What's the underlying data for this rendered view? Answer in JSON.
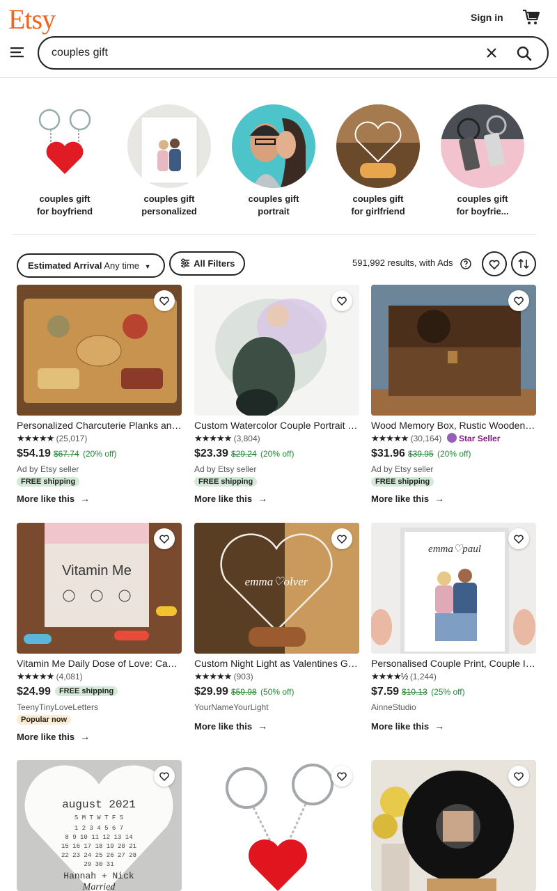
{
  "header": {
    "logo": "Etsy",
    "sign_in": "Sign in",
    "search_value": "couples gift"
  },
  "related": [
    {
      "line1": "couples gift",
      "line2": "for boyfriend"
    },
    {
      "line1": "couples gift",
      "line2": "personalized"
    },
    {
      "line1": "couples gift",
      "line2": "portrait"
    },
    {
      "line1": "couples gift",
      "line2": "for girlfriend"
    },
    {
      "line1": "couples gift",
      "line2": "for boyfrie..."
    }
  ],
  "filters": {
    "arrival_label": "Estimated Arrival",
    "arrival_value": "Any time",
    "all_filters": "All Filters",
    "results": "591,992 results, with Ads"
  },
  "listings": [
    {
      "title": "Personalized Charcuterie Planks and Cheese Board",
      "stars": "★★★★★",
      "reviews": "(25,017)",
      "price": "$54.19",
      "orig": "$67.74",
      "disc": "(20% off)",
      "seller": "Ad by Etsy seller",
      "badge": "FREE shipping",
      "more": "More like this"
    },
    {
      "title": "Custom Watercolor Couple Portrait from Photo",
      "stars": "★★★★★",
      "reviews": "(3,804)",
      "price": "$23.39",
      "orig": "$29.24",
      "disc": "(20% off)",
      "seller": "Ad by Etsy seller",
      "badge": "FREE shipping",
      "more": "More like this"
    },
    {
      "title": "Wood Memory Box, Rustic Wooden Keepsake Box",
      "stars": "★★★★★",
      "reviews": "(30,164)",
      "star_seller": "Star Seller",
      "price": "$31.96",
      "orig": "$39.95",
      "disc": "(20% off)",
      "seller": "Ad by Etsy seller",
      "badge": "FREE shipping",
      "more": "More like this"
    },
    {
      "title": "Vitamin Me Daily Dose of Love: Capsules Gift",
      "stars": "★★★★★",
      "reviews": "(4,081)",
      "price": "$24.99",
      "inline_badge": "FREE shipping",
      "seller": "TeenyTinyLoveLetters",
      "badge": "Popular now",
      "more": "More like this"
    },
    {
      "title": "Custom Night Light as Valentines Gift for Him",
      "stars": "★★★★★",
      "reviews": "(903)",
      "price": "$29.99",
      "orig": "$59.98",
      "disc": "(50% off)",
      "seller": "YourNameYourLight",
      "more": "More like this"
    },
    {
      "title": "Personalised Couple Print, Couple Illustration",
      "stars": "★★★★½",
      "reviews": "(1,244)",
      "price": "$7.59",
      "orig": "$10.13",
      "disc": "(25% off)",
      "seller": "AinneStudio",
      "more": "More like this"
    }
  ],
  "image_text": {
    "calendar_month": "august 2021",
    "calendar_names": "Hannah + Nick",
    "calendar_word": "Married",
    "vitamin_title": "Vitamin Me",
    "light_names": "emma♡olver",
    "print_names": "emma♡paul"
  },
  "colors": {
    "brand": "#f1641e",
    "sale": "#258635",
    "free_ship_bg": "#d4e9d7",
    "star_seller": "#7f187f"
  }
}
